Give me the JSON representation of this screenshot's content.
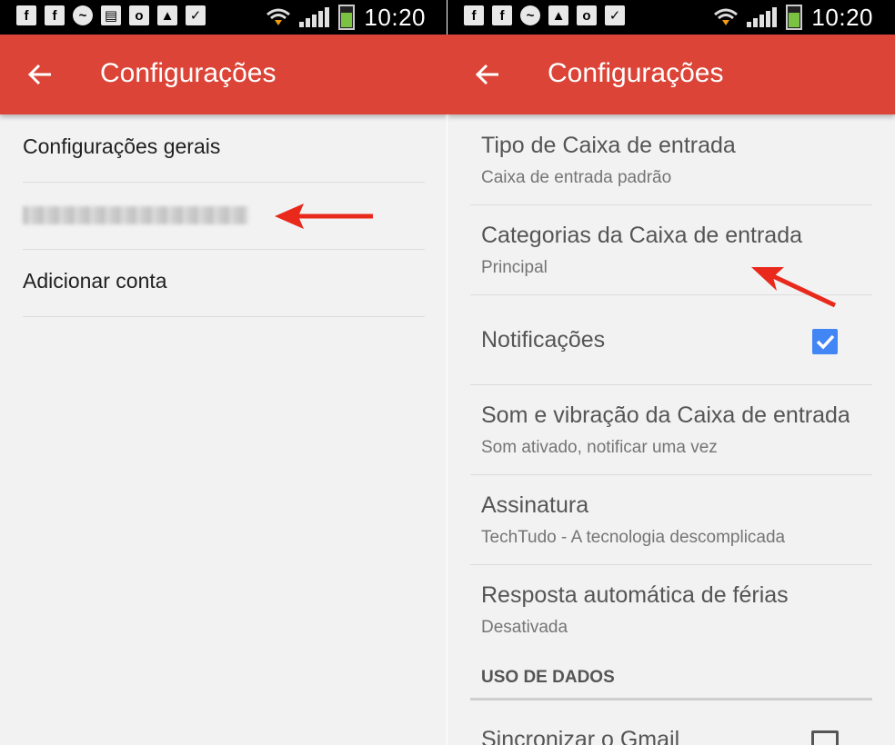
{
  "status_bar": {
    "time": "10:20",
    "icons": [
      "facebook-icon",
      "facebook-icon",
      "messenger-icon",
      "sd-card-icon",
      "outlook-icon",
      "gallery-icon",
      "clipboard-check-icon"
    ]
  },
  "left": {
    "title": "Configurações",
    "items": [
      {
        "label": "Configurações gerais"
      },
      {
        "label": ""
      },
      {
        "label": "Adicionar conta"
      }
    ]
  },
  "right": {
    "title": "Configurações",
    "items": [
      {
        "title": "Tipo de Caixa de entrada",
        "subtitle": "Caixa de entrada padrão"
      },
      {
        "title": "Categorias da Caixa de entrada",
        "subtitle": "Principal"
      },
      {
        "title": "Notificações",
        "checked": true
      },
      {
        "title": "Som e vibração da Caixa de entrada",
        "subtitle": "Som ativado, notificar uma vez"
      },
      {
        "title": "Assinatura",
        "subtitle": "TechTudo - A tecnologia descomplicada"
      },
      {
        "title": "Resposta automática de férias",
        "subtitle": "Desativada"
      }
    ],
    "section": "USO DE DADOS",
    "sync_label": "Sincronizar o Gmail"
  },
  "colors": {
    "appbar": "#db4437",
    "checkbox": "#4285f4",
    "annotation_arrow": "#e8291c"
  }
}
